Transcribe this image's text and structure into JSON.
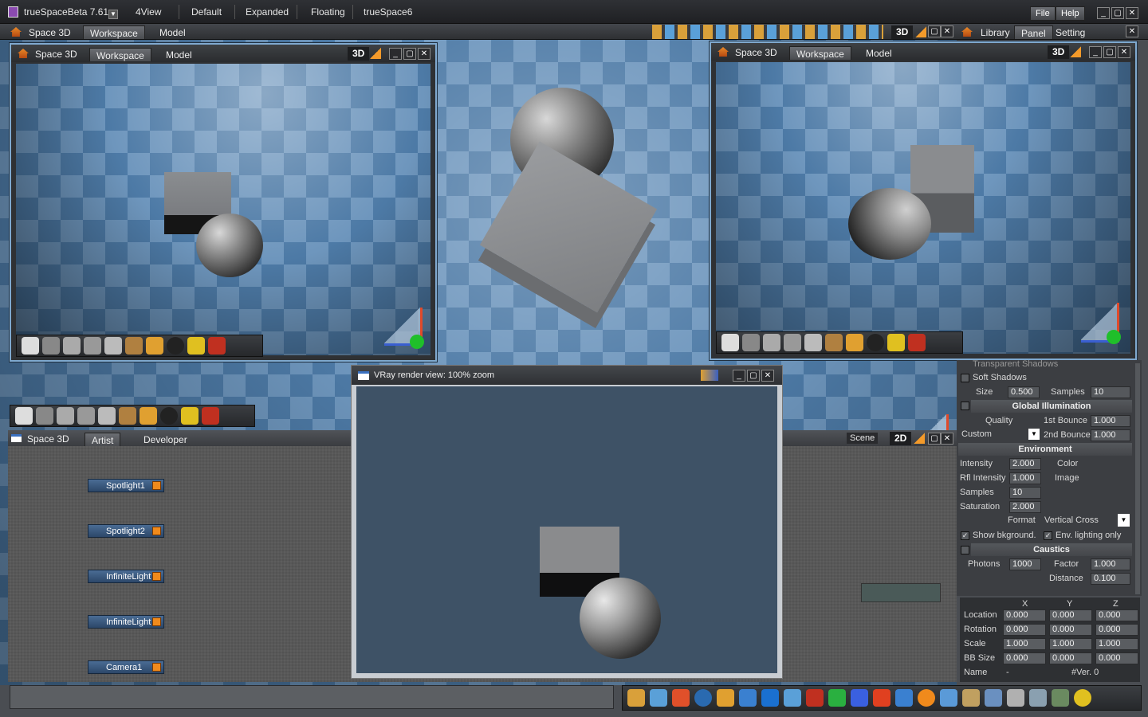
{
  "app": {
    "title": "trueSpaceBeta 7.61"
  },
  "layouts": [
    "4View",
    "Default",
    "Expanded",
    "Floating",
    "trueSpace6"
  ],
  "menu": {
    "file": "File",
    "help": "Help"
  },
  "space": {
    "title": "Space 3D",
    "tabs": [
      "Workspace",
      "Model"
    ]
  },
  "view_mode": "3D",
  "right_tabs": [
    "Library",
    "Panel",
    "Setting"
  ],
  "viewport_left": {
    "title": "Space 3D",
    "tabs": [
      "Workspace",
      "Model"
    ],
    "mode": "3D"
  },
  "viewport_right": {
    "title": "Space 3D",
    "tabs": [
      "Workspace",
      "Model"
    ],
    "mode": "3D"
  },
  "link_editor": {
    "title": "Space 3D",
    "tabs": [
      "Artist",
      "Developer"
    ],
    "mode": "2D",
    "scene_label": "Scene",
    "nodes": [
      "Spotlight1",
      "Spotlight2",
      "InfiniteLight",
      "InfiniteLight",
      "Camera1"
    ]
  },
  "vray": {
    "title": "VRay render view: 100% zoom"
  },
  "settings": {
    "partial_top": "Transparent Shadows",
    "soft_shadows": "Soft Shadows",
    "size_label": "Size",
    "size_value": "0.500",
    "samples_label": "Samples",
    "samples_value": "10",
    "gi_header": "Global Illumination",
    "quality_label": "Quality",
    "first_bounce_label": "1st Bounce",
    "first_bounce_value": "1.000",
    "custom_label": "Custom",
    "second_bounce_label": "2nd Bounces",
    "second_bounce_value": "1.000",
    "env_header": "Environment",
    "intensity_label": "Intensity",
    "intensity_value": "2.000",
    "color_label": "Color",
    "rfl_label": "Rfl Intensity",
    "rfl_value": "1.000",
    "image_label": "Image",
    "env_samples_label": "Samples",
    "env_samples_value": "10",
    "saturation_label": "Saturation",
    "saturation_value": "2.000",
    "format_label": "Format",
    "format_value": "Vertical Cross",
    "show_bkg": "Show bkground.",
    "env_lighting": "Env. lighting only",
    "caustics_header": "Caustics",
    "photons_label": "Photons",
    "photons_value": "1000",
    "factor_label": "Factor",
    "factor_value": "1.000",
    "distance_label": "Distance",
    "distance_value": "0.100"
  },
  "transform": {
    "cols": [
      "X",
      "Y",
      "Z"
    ],
    "rows": [
      {
        "label": "Location",
        "values": [
          "0.000",
          "0.000",
          "0.000"
        ]
      },
      {
        "label": "Rotation",
        "values": [
          "0.000",
          "0.000",
          "0.000"
        ]
      },
      {
        "label": "Scale",
        "values": [
          "1.000",
          "1.000",
          "1.000"
        ]
      },
      {
        "label": "BB Size",
        "values": [
          "0.000",
          "0.000",
          "0.000"
        ]
      }
    ],
    "name_label": "Name",
    "name_value": "-",
    "version": "#Ver. 0"
  },
  "colors": {
    "accent": "#f39a2a",
    "viewport_border": "#7fa9cf",
    "node": "#2c4769",
    "floor": "#4d7aa6"
  }
}
